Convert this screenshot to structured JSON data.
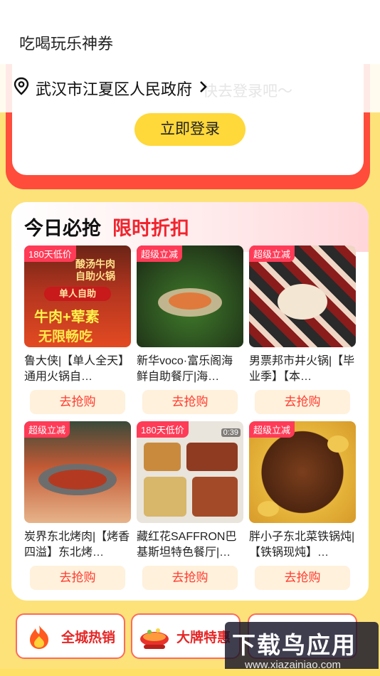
{
  "header": {
    "title": "吃喝玩乐神券"
  },
  "location": {
    "text": "武汉市江夏区人民政府",
    "ghost_text": "快去登录吧～"
  },
  "login": {
    "button_label": "立即登录"
  },
  "deals": {
    "title": "今日必抢",
    "subtitle": "限时折扣",
    "buy_label": "去抢购",
    "items": [
      {
        "tag": "180天低价",
        "name": "鲁大侠|【单人全天】通用火锅自…",
        "image_text_1": "酸汤牛肉",
        "image_text_2": "自助火锅",
        "image_text_3": "单人自助",
        "image_text_4": "牛肉+荤素",
        "image_text_5": "无限畅吃"
      },
      {
        "tag": "超级立减",
        "name": "新华voco·富乐阁海鲜自助餐厅|海…"
      },
      {
        "tag": "超级立减",
        "name": "男票邦市井火锅|【毕业季】【本…"
      },
      {
        "tag": "超级立减",
        "name": "炭界东北烤肉|【烤香四溢】东北烤…"
      },
      {
        "tag": "180天低价",
        "name": "藏红花SAFFRON巴基斯坦特色餐厅|…",
        "image_text_1": "0:39"
      },
      {
        "tag": "超级立减",
        "name": "胖小子东北菜铁锅炖|【铁锅现炖】…"
      }
    ]
  },
  "bottom_buttons": [
    {
      "label": "全城热销"
    },
    {
      "label": "大牌特惠"
    },
    {
      "label": ""
    }
  ],
  "watermark": {
    "title": "下载鸟应用",
    "url": "www.xiazainiao.com"
  },
  "colors": {
    "accent_red": "#f0242e",
    "login_yellow": "#ffd83a",
    "tag_pink": "#ff3b57",
    "page_bg": "#fde27a"
  }
}
